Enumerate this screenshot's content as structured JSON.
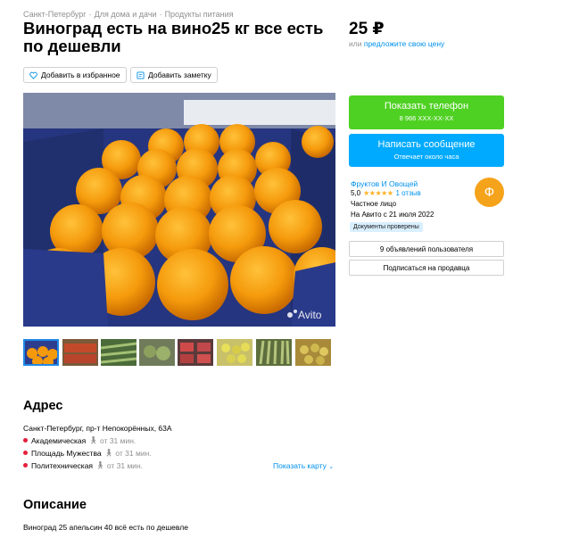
{
  "breadcrumb": [
    "Санкт-Петербург",
    "Для дома и дачи",
    "Продукты питания"
  ],
  "listing": {
    "title": "Виноград есть на вино25 кг все есть по дешевли",
    "price": "25 ₽",
    "price_or": "или",
    "price_offer_link": "предложите свою цену"
  },
  "actions": {
    "favorite": "Добавить в избранное",
    "note": "Добавить заметку"
  },
  "photo": {
    "watermark": "Avito"
  },
  "contact": {
    "show_phone": "Показать телефон",
    "phone_masked": "8 966 XXX-XX-XX",
    "write_message": "Написать сообщение",
    "reply_time": "Отвечает около часа"
  },
  "seller": {
    "name": "Фруктов И Овощей",
    "rating": "5,0",
    "stars": "★★★★★",
    "reviews": "1 отзыв",
    "type": "Частное лицо",
    "since": "На Авито с 21 июля 2022",
    "badge": "Документы проверены",
    "avatar_letter": "Ф",
    "all_ads": "9 объявлений пользователя",
    "subscribe": "Подписаться на продавца"
  },
  "address": {
    "heading": "Адрес",
    "line": "Санкт-Петербург, пр-т Непокорённых, 63А",
    "metro": [
      {
        "name": "Академическая",
        "time": "от 31 мин."
      },
      {
        "name": "Площадь Мужества",
        "time": "от 31 мин."
      },
      {
        "name": "Политехническая",
        "time": "от 31 мин."
      }
    ],
    "show_map": "Показать карту"
  },
  "description": {
    "heading": "Описание",
    "text": "Виноград 25 апельсин 40 всё есть по дешевле"
  },
  "colors": {
    "green": "#4fd123",
    "blue": "#00aaff",
    "link": "#0091ea",
    "avatar": "#f5a31a",
    "star": "#ffb021",
    "metro_dot": "#e41e3a"
  }
}
